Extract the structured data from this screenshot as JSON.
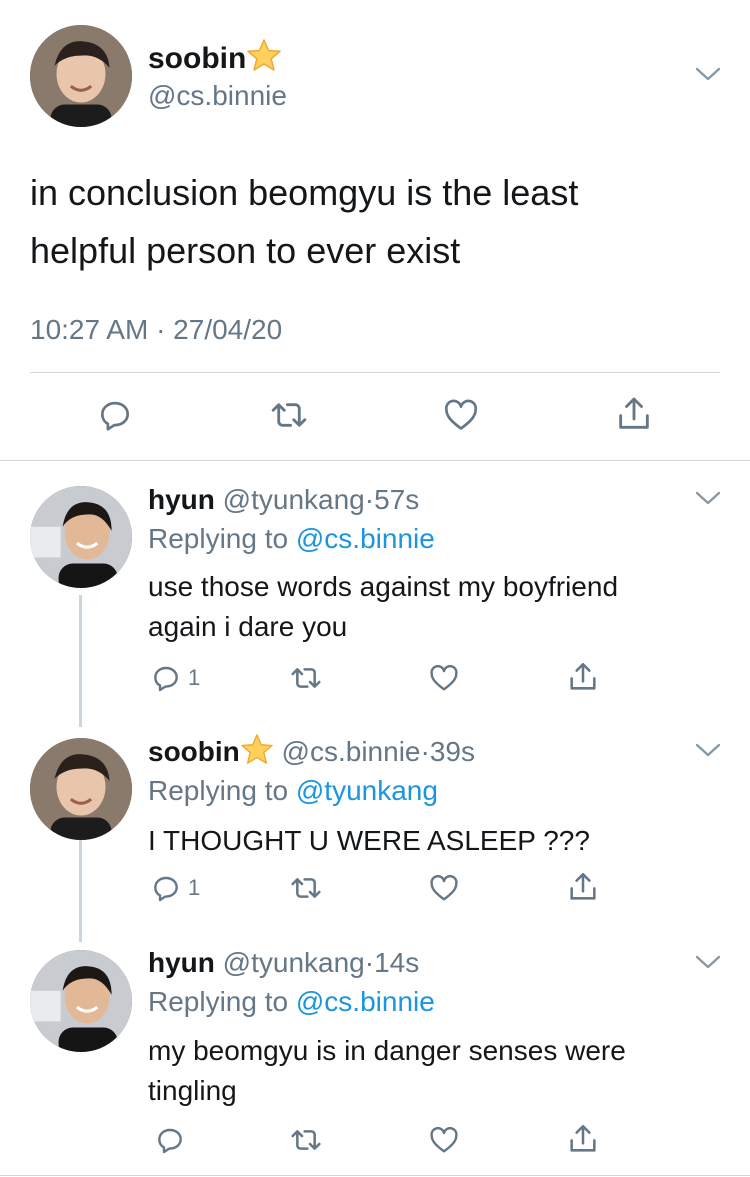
{
  "main_tweet": {
    "name": "soobin",
    "handle": "@cs.binnie",
    "text_line1": "in conclusion beomgyu is the least",
    "text_line2": "helpful person to ever exist",
    "timestamp": "10:27 AM · 27/04/20"
  },
  "replies": [
    {
      "name": "hyun",
      "handle": "@tyunkang",
      "sep": "·",
      "age": "57s",
      "replying_prefix": "Replying to",
      "replying_to": "@cs.binnie",
      "text_line1": "use those words against my boyfriend",
      "text_line2": "again i dare you",
      "reply_count": "1"
    },
    {
      "name": "soobin",
      "handle": "@cs.binnie",
      "sep": "·",
      "age": "39s",
      "replying_prefix": "Replying to",
      "replying_to": "@tyunkang",
      "text_line1": "I THOUGHT U WERE ASLEEP ???",
      "reply_count": "1"
    },
    {
      "name": "hyun",
      "handle": "@tyunkang",
      "sep": "·",
      "age": "14s",
      "replying_prefix": "Replying to",
      "replying_to": "@cs.binnie",
      "text_line1": "my beomgyu is in danger senses were",
      "text_line2": "tingling"
    }
  ],
  "colors": {
    "link": "#1b95e0",
    "secondary_text": "#657786",
    "star": "#ffd15c"
  },
  "icons": [
    "chevron-down-icon",
    "reply-icon",
    "retweet-icon",
    "like-icon",
    "share-icon",
    "star-emoji-icon"
  ]
}
